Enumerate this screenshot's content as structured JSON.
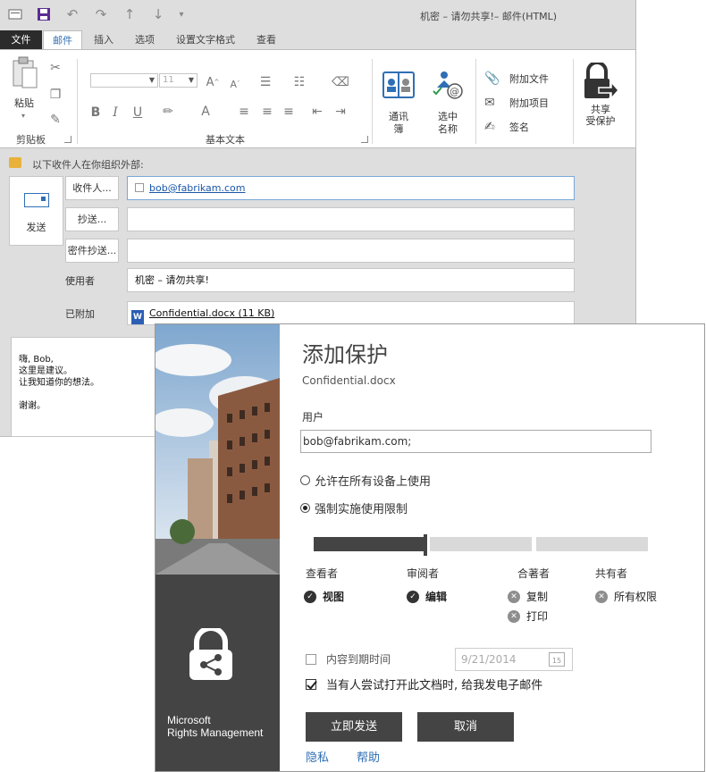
{
  "window": {
    "title": "机密 – 请勿共享!– 邮件(HTML)"
  },
  "tabs": [
    {
      "label": "文件"
    },
    {
      "label": "邮件"
    },
    {
      "label": "插入"
    },
    {
      "label": "选项"
    },
    {
      "label": "设置文字格式"
    },
    {
      "label": "查看"
    }
  ],
  "ribbon": {
    "paste_label": "粘贴",
    "clipboard_group": "剪贴板",
    "font_size_value": "11",
    "basic_text_group": "基本文本",
    "address_book": [
      "通讯",
      "簿"
    ],
    "check_names": [
      "选中",
      "名称"
    ],
    "attach_file": "附加文件",
    "attach_item": "附加项目",
    "signature": "签名",
    "share_protect": [
      "共享",
      "受保护"
    ]
  },
  "compose": {
    "info_text": "以下收件人在你组织外部:",
    "send_label": "发送",
    "to_button": "收件人...",
    "to_value": "bob@fabrikam.com",
    "cc_button": "抄送...",
    "bcc_button": "密件抄送...",
    "subject_label": "使用者",
    "subject_value": "机密 – 请勿共享!",
    "attached_label": "已附加",
    "attachment": "Confidential.docx (11 KB)",
    "body": [
      "嗨, Bob,",
      "这里是建议。",
      "让我知道你的想法。",
      "",
      "谢谢。"
    ]
  },
  "dialog": {
    "title": "添加保护",
    "file": "Confidential.docx",
    "users_label": "用户",
    "users_value": "bob@fabrikam.com;",
    "option_all_devices": "允许在所有设备上使用",
    "option_enforce": "强制实施使用限制",
    "levels": {
      "viewer": "查看者",
      "reviewer": "审阅者",
      "coauthor": "合著者",
      "coowner": "共有者"
    },
    "selected_level": "审阅者",
    "perms": {
      "view": "视图",
      "edit": "编辑",
      "copy": "复制",
      "print": "打印",
      "full": "所有权限"
    },
    "expire_label": "内容到期时间",
    "expire_date": "9/21/2014",
    "calendar_day": "15",
    "email_me_label": "当有人尝试打开此文档时, 给我发电子邮件",
    "send_now": "立即发送",
    "cancel": "取消",
    "privacy": "隐私",
    "help": "帮助",
    "brand": [
      "Microsoft",
      "Rights Management"
    ],
    "colors": {
      "dark": "#444444",
      "track": "#d9d9d9",
      "link": "#2f6fb5"
    }
  }
}
